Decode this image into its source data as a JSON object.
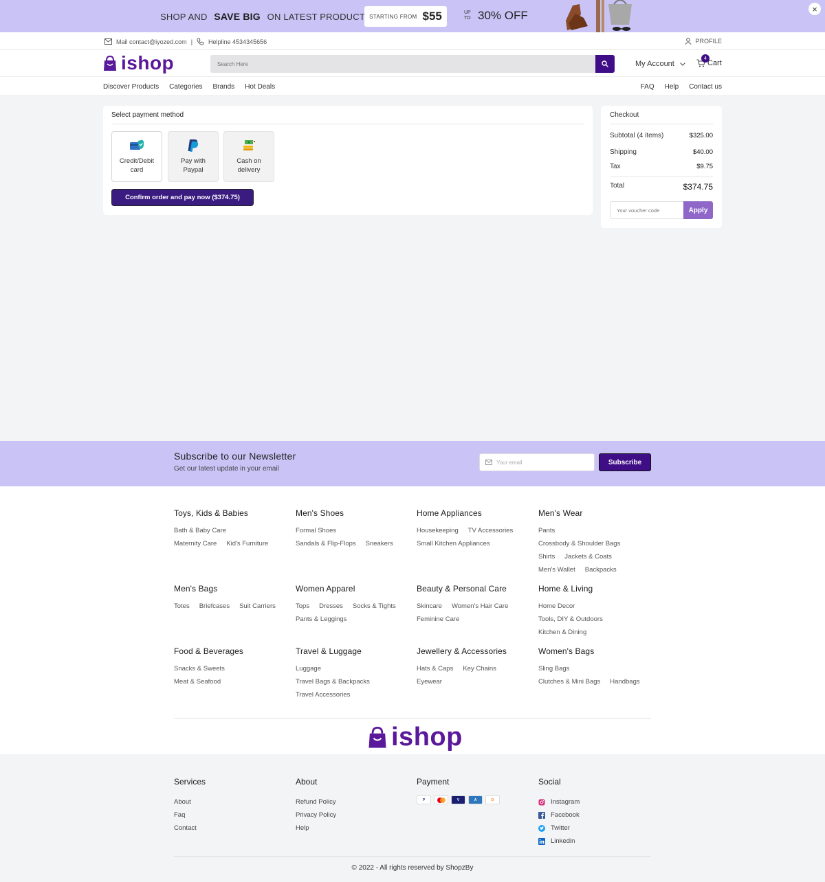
{
  "promo": {
    "shop_and": "SHOP AND",
    "save_big": "SAVE BIG",
    "on_latest": "ON LATEST PRODUCTS",
    "starting_from": "STARTING FROM",
    "price": "$55",
    "up_to": "UP TO",
    "discount": "30% OFF",
    "close": "×"
  },
  "infobar": {
    "mail": "Mail contact@iyozed.com",
    "divider": "|",
    "helpline": "Helpline 4534345656",
    "profile": "PROFILE"
  },
  "header": {
    "logo": "ishop",
    "search_placeholder": "Search Here",
    "account": "My Account",
    "cart_label": "Cart",
    "cart_count": "4"
  },
  "nav": {
    "left": [
      "Discover Products",
      "Categories",
      "Brands",
      "Hot Deals"
    ],
    "right": [
      "FAQ",
      "Help",
      "Contact us"
    ]
  },
  "payment": {
    "title": "Select payment method",
    "methods": [
      {
        "line1": "Credit/Debit",
        "line2": "card",
        "icon": "credit-card-icon"
      },
      {
        "line1": "Pay with",
        "line2": "Paypal",
        "icon": "paypal-icon"
      },
      {
        "line1": "Cash on",
        "line2": "delivery",
        "icon": "cash-icon"
      }
    ],
    "confirm": "Confirm order and pay now ($374.75)"
  },
  "checkout": {
    "title": "Checkout",
    "subtotal_label": "Subtotal (4 items)",
    "subtotal": "$325.00",
    "shipping_label": "Shipping",
    "shipping": "$40.00",
    "tax_label": "Tax",
    "tax": "$9.75",
    "total_label": "Total",
    "total": "$374.75",
    "voucher_placeholder": "Your voucher code",
    "apply": "Apply"
  },
  "newsletter": {
    "title": "Subscribe to our Newsletter",
    "subtitle": "Get our latest update in your email",
    "placeholder": "Your email",
    "button": "Subscribe"
  },
  "categories": [
    {
      "title": "Toys, Kids & Babies",
      "rows": [
        [
          "Bath & Baby Care"
        ],
        [
          "Maternity Care",
          "Kid's Furniture"
        ]
      ]
    },
    {
      "title": "Men's Shoes",
      "rows": [
        [
          "Formal Shoes"
        ],
        [
          "Sandals & Flip-Flops",
          "Sneakers"
        ]
      ]
    },
    {
      "title": "Home Appliances",
      "rows": [
        [
          "Housekeeping",
          "TV Accessories"
        ],
        [
          "Small Kitchen Appliances"
        ]
      ]
    },
    {
      "title": "Men's Wear",
      "rows": [
        [
          "Pants"
        ],
        [
          "Crossbody & Shoulder Bags"
        ],
        [
          "Shirts",
          "Jackets & Coats"
        ],
        [
          "Men's Wallet",
          "Backpacks"
        ]
      ]
    },
    {
      "title": "Men's Bags",
      "rows": [
        [
          "Totes",
          "Briefcases",
          "Suit Carriers"
        ]
      ]
    },
    {
      "title": "Women Apparel",
      "rows": [
        [
          "Tops",
          "Dresses",
          "Socks & Tights"
        ],
        [
          "Pants & Leggings"
        ]
      ]
    },
    {
      "title": "Beauty & Personal Care",
      "rows": [
        [
          "Skincare",
          "Women's Hair Care"
        ],
        [
          "Feminine Care"
        ]
      ]
    },
    {
      "title": "Home & Living",
      "rows": [
        [
          "Home Decor"
        ],
        [
          "Tools, DIY & Outdoors"
        ],
        [
          "Kitchen & Dining"
        ]
      ]
    },
    {
      "title": "Food & Beverages",
      "rows": [
        [
          "Snacks & Sweets"
        ],
        [
          "Meat & Seafood"
        ]
      ]
    },
    {
      "title": "Travel & Luggage",
      "rows": [
        [
          "Luggage"
        ],
        [
          "Travel Bags & Backpacks"
        ],
        [
          "Travel Accessories"
        ]
      ]
    },
    {
      "title": "Jewellery & Accessories",
      "rows": [
        [
          "Hats & Caps",
          "Key Chains"
        ],
        [
          "Eyewear"
        ]
      ]
    },
    {
      "title": "Women's Bags",
      "rows": [
        [
          "Sling Bags"
        ],
        [
          "Clutches & Mini Bags",
          "Handbags"
        ]
      ]
    }
  ],
  "footer": {
    "logo": "ishop",
    "services_title": "Services",
    "services": [
      "About",
      "Faq",
      "Contact"
    ],
    "about_title": "About",
    "about": [
      "Refund Policy",
      "Privacy Policy",
      "Help"
    ],
    "payment_title": "Payment",
    "payment_cards": [
      "PayPal",
      "Mastercard",
      "Visa",
      "Amex",
      "Discover"
    ],
    "social_title": "Social",
    "social": [
      {
        "label": "Instagram",
        "icon": "instagram-icon",
        "color": "#d62976"
      },
      {
        "label": "Facebook",
        "icon": "facebook-icon",
        "color": "#3b5998"
      },
      {
        "label": "Twitter",
        "icon": "twitter-icon",
        "color": "#1da1f2"
      },
      {
        "label": "Linkedin",
        "icon": "linkedin-icon",
        "color": "#0a66c2"
      }
    ],
    "copyright": "© 2022 - All rights reserved by ShopzBy"
  },
  "colors": {
    "brand": "#5a189a",
    "brand_dark": "#3f0d86",
    "banner_bg": "#c9c3f6",
    "apply_bg": "#8e67c9"
  }
}
